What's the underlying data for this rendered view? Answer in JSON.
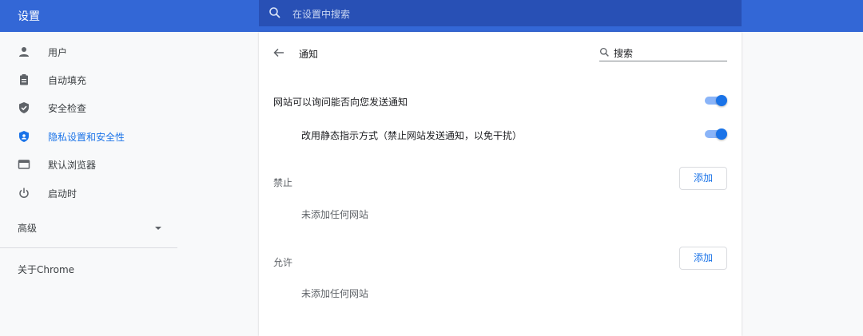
{
  "app": {
    "title": "设置"
  },
  "search": {
    "placeholder": "在设置中搜索"
  },
  "sidebar": {
    "items": [
      {
        "label": "用户",
        "icon": "person-icon"
      },
      {
        "label": "自动填充",
        "icon": "clipboard-icon"
      },
      {
        "label": "安全检查",
        "icon": "shield-check-icon"
      },
      {
        "label": "隐私设置和安全性",
        "icon": "privacy-shield-icon",
        "active": true
      },
      {
        "label": "默认浏览器",
        "icon": "browser-window-icon"
      },
      {
        "label": "启动时",
        "icon": "power-icon"
      }
    ],
    "advanced": "高级",
    "about": "关于Chrome"
  },
  "main": {
    "title": "通知",
    "search_value": "搜索",
    "ask_toggle_label": "网站可以询问能否向您发送通知",
    "quiet_toggle_label": "改用静态指示方式（禁止网站发送通知，以免干扰）",
    "blocked": {
      "label": "禁止",
      "add_label": "添加",
      "empty": "未添加任何网站"
    },
    "allowed": {
      "label": "允许",
      "add_label": "添加",
      "empty": "未添加任何网站"
    }
  },
  "colors": {
    "accent": "#1a73e8",
    "header": "#3367d6",
    "search_bg": "#2850b5"
  }
}
